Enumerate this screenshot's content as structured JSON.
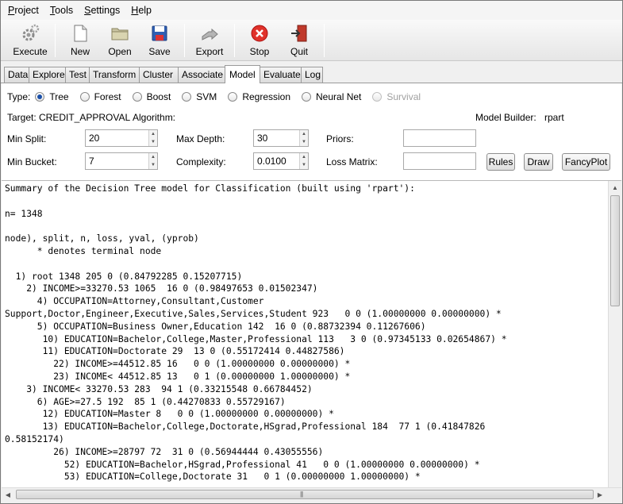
{
  "menubar": [
    {
      "first": "P",
      "rest": "roject"
    },
    {
      "first": "T",
      "rest": "ools"
    },
    {
      "first": "S",
      "rest": "ettings"
    },
    {
      "first": "H",
      "rest": "elp"
    }
  ],
  "toolbar": {
    "execute": "Execute",
    "new": "New",
    "open": "Open",
    "save": "Save",
    "export": "Export",
    "stop": "Stop",
    "quit": "Quit"
  },
  "tabs": [
    "Data",
    "Explore",
    "Test",
    "Transform",
    "Cluster",
    "Associate",
    "Model",
    "Evaluate",
    "Log"
  ],
  "active_tab": "Model",
  "model": {
    "type_label": "Type:",
    "types": [
      {
        "label": "Tree",
        "selected": true
      },
      {
        "label": "Forest"
      },
      {
        "label": "Boost"
      },
      {
        "label": "SVM"
      },
      {
        "label": "Regression"
      },
      {
        "label": "Neural Net"
      },
      {
        "label": "Survival",
        "disabled": true
      }
    ],
    "target": "Target: CREDIT_APPROVAL",
    "algorithm": "Algorithm:",
    "builder_label": "Model Builder:",
    "builder_value": "rpart",
    "min_split_label": "Min Split:",
    "min_split": "20",
    "max_depth_label": "Max Depth:",
    "max_depth": "30",
    "priors_label": "Priors:",
    "min_bucket_label": "Min Bucket:",
    "min_bucket": "7",
    "complexity_label": "Complexity:",
    "complexity": "0.0100",
    "loss_label": "Loss Matrix:",
    "rules": "Rules",
    "draw": "Draw",
    "fancyplot": "FancyPlot"
  },
  "output": [
    "Summary of the Decision Tree model for Classification (built using 'rpart'):",
    "",
    "n= 1348",
    "",
    "node), split, n, loss, yval, (yprob)",
    "      * denotes terminal node",
    "",
    "  1) root 1348 205 0 (0.84792285 0.15207715)",
    "    2) INCOME>=33270.53 1065  16 0 (0.98497653 0.01502347)",
    "      4) OCCUPATION=Attorney,Consultant,Customer",
    "Support,Doctor,Engineer,Executive,Sales,Services,Student 923   0 0 (1.00000000 0.00000000) *",
    "      5) OCCUPATION=Business Owner,Education 142  16 0 (0.88732394 0.11267606)",
    "       10) EDUCATION=Bachelor,College,Master,Professional 113   3 0 (0.97345133 0.02654867) *",
    "       11) EDUCATION=Doctorate 29  13 0 (0.55172414 0.44827586)",
    "         22) INCOME>=44512.85 16   0 0 (1.00000000 0.00000000) *",
    "         23) INCOME< 44512.85 13   0 1 (0.00000000 1.00000000) *",
    "    3) INCOME< 33270.53 283  94 1 (0.33215548 0.66784452)",
    "      6) AGE>=27.5 192  85 1 (0.44270833 0.55729167)",
    "       12) EDUCATION=Master 8   0 0 (1.00000000 0.00000000) *",
    "       13) EDUCATION=Bachelor,College,Doctorate,HSgrad,Professional 184  77 1 (0.41847826",
    "0.58152174)",
    "         26) INCOME>=28797 72  31 0 (0.56944444 0.43055556)",
    "           52) EDUCATION=Bachelor,HSgrad,Professional 41   0 0 (1.00000000 0.00000000) *",
    "           53) EDUCATION=College,Doctorate 31   0 1 (0.00000000 1.00000000) *"
  ]
}
